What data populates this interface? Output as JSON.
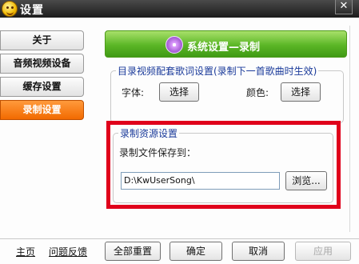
{
  "window": {
    "title": "设置",
    "close_glyph": "✕"
  },
  "sidebar": {
    "items": [
      {
        "label": "关于",
        "active": false
      },
      {
        "label": "音频视频设备",
        "active": false
      },
      {
        "label": "缓存设置",
        "active": false
      },
      {
        "label": "录制设置",
        "active": true
      }
    ]
  },
  "header": {
    "title": "系统设置—录制",
    "icon": "flower-icon"
  },
  "lyrics_group": {
    "legend": "目录视频配套歌词设置(录制下一首歌曲时生效)",
    "font_label": "字体:",
    "font_button": "选择",
    "color_label": "颜色:",
    "color_button": "选择"
  },
  "record_group": {
    "legend": "录制资源设置",
    "save_to_label": "录制文件保存到：",
    "path_value": "D:\\KwUserSong\\",
    "browse_button": "浏览..."
  },
  "footer": {
    "home_link": "主页",
    "feedback_link": "问题反馈",
    "reset_all": "全部重置",
    "ok": "确定",
    "cancel": "取消",
    "apply": "应用"
  },
  "colors": {
    "active_tab": "#f26a00",
    "header_green": "#5bb626",
    "highlight_red": "#e0001b",
    "legend_blue": "#1a3a9a"
  }
}
